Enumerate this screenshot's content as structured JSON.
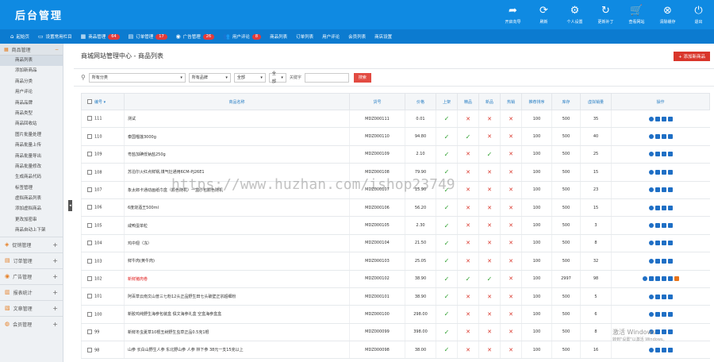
{
  "header": {
    "brand": "后台管理",
    "tools": [
      {
        "icon": "share-arrow-icon",
        "glyph": "➦",
        "label": "开启向导"
      },
      {
        "icon": "refresh-icon",
        "glyph": "⟳",
        "label": "刷新"
      },
      {
        "icon": "gear-icon",
        "glyph": "⚙",
        "label": "个人设置"
      },
      {
        "icon": "update-icon",
        "glyph": "↻",
        "label": "更新补丁"
      },
      {
        "icon": "cart-icon",
        "glyph": "🛒",
        "label": "查看网站"
      },
      {
        "icon": "clear-cache-icon",
        "glyph": "⊗",
        "label": "清除缓存"
      },
      {
        "icon": "power-icon",
        "glyph": "⏻",
        "label": "退出"
      }
    ]
  },
  "nav": [
    {
      "icon": "home-icon",
      "glyph": "⌂",
      "label": "起始页"
    },
    {
      "icon": "monitor-icon",
      "glyph": "▭",
      "label": "设置常用栏目"
    },
    {
      "icon": "goods-icon",
      "glyph": "▦",
      "label": "商品管理",
      "badge": "64"
    },
    {
      "icon": "order-icon",
      "glyph": "▤",
      "label": "订单管理",
      "badge": "17"
    },
    {
      "icon": "ad-icon",
      "glyph": "◉",
      "label": "广告管理",
      "badge": "26"
    },
    {
      "icon": "user-comment-icon",
      "glyph": "👥",
      "label": "用户评论",
      "badge": "8"
    },
    {
      "icon": "",
      "glyph": "",
      "label": "商品列表"
    },
    {
      "icon": "",
      "glyph": "",
      "label": "订单列表"
    },
    {
      "icon": "",
      "glyph": "",
      "label": "用户评论"
    },
    {
      "icon": "",
      "glyph": "",
      "label": "会员列表"
    },
    {
      "icon": "",
      "glyph": "",
      "label": "商店设置"
    }
  ],
  "sidebar": {
    "head": "商品管理",
    "items": [
      "商品列表",
      "添加新商品",
      "商品分类",
      "用户评论",
      "商品品牌",
      "商品类型",
      "商品回收站",
      "图片批量处理",
      "商品批量上传",
      "商品批量导出",
      "商品批量修改",
      "生成商品代码",
      "标签管理",
      "虚拟商品列表",
      "添加虚拟商品",
      "更改加密串",
      "商品自动上下架"
    ],
    "groups": [
      "促销管理",
      "订单管理",
      "广告管理",
      "报表统计",
      "文章管理",
      "会员管理"
    ]
  },
  "main": {
    "title": "商城网站管理中心 - 商品列表",
    "add_button": "+ 添加新商品",
    "filter": {
      "category": "所有分类",
      "brand": "所有品牌",
      "all1": "全部",
      "all2": "全部",
      "keyword_label": "关键字",
      "search": "搜索"
    },
    "columns": [
      "编号",
      "商品名称",
      "货号",
      "价格",
      "上架",
      "精品",
      "新品",
      "热销",
      "推荐排序",
      "库存",
      "虚拟销量",
      "操作"
    ],
    "rows": [
      {
        "id": "111",
        "name": "测试",
        "sku": "MDZ000111",
        "price": "0.01",
        "on": 1,
        "best": 0,
        "new": 0,
        "hot": 0,
        "sort": "100",
        "stock": "500",
        "virtual": "35"
      },
      {
        "id": "110",
        "name": "泰国榴莲3000g",
        "sku": "MDZ000110",
        "price": "94.80",
        "on": 1,
        "best": 1,
        "new": 0,
        "hot": 0,
        "sort": "100",
        "stock": "500",
        "virtual": "40"
      },
      {
        "id": "109",
        "name": "粤盐加碘低钠盐250g",
        "sku": "MDZ000109",
        "price": "2.10",
        "on": 1,
        "best": 0,
        "new": 1,
        "hot": 0,
        "sort": "100",
        "stock": "500",
        "virtual": "25"
      },
      {
        "id": "108",
        "name": "苏泊尔火红点鲜锅,煤气灶通用6CM-PJ26E1",
        "sku": "MDZ000108",
        "price": "79.90",
        "on": 1,
        "best": 0,
        "new": 0,
        "hot": 0,
        "sort": "100",
        "stock": "500",
        "virtual": "15"
      },
      {
        "id": "107",
        "name": "象太郎卡通动画纸巾盒（颜色随机）一盒小包颜色随机",
        "sku": "MDZ000107",
        "price": "15.90",
        "on": 1,
        "best": 0,
        "new": 0,
        "hot": 0,
        "sort": "100",
        "stock": "500",
        "virtual": "23"
      },
      {
        "id": "106",
        "name": "6度烧酒王500ml",
        "sku": "MDZ000106",
        "price": "56.20",
        "on": 1,
        "best": 0,
        "new": 0,
        "hot": 0,
        "sort": "100",
        "stock": "500",
        "virtual": "15"
      },
      {
        "id": "105",
        "name": "咸鸭蛋单粒",
        "sku": "MDZ000105",
        "price": "2.30",
        "on": 1,
        "best": 0,
        "new": 0,
        "hot": 0,
        "sort": "100",
        "stock": "500",
        "virtual": "3"
      },
      {
        "id": "104",
        "name": "鸡中翅（冻）",
        "sku": "MDZ000104",
        "price": "21.50",
        "on": 1,
        "best": 0,
        "new": 0,
        "hot": 0,
        "sort": "100",
        "stock": "500",
        "virtual": "8"
      },
      {
        "id": "103",
        "name": "鲜牛肉(黄牛肉)",
        "sku": "MDZ000103",
        "price": "25.05",
        "on": 1,
        "best": 0,
        "new": 0,
        "hot": 0,
        "sort": "100",
        "stock": "500",
        "virtual": "32"
      },
      {
        "id": "102",
        "name": "新鲜猪肉卷",
        "sku": "MDZ000102",
        "price": "38.90",
        "on": 1,
        "best": 1,
        "new": 1,
        "hot": 0,
        "sort": "100",
        "stock": "2997",
        "virtual": "98",
        "red": true
      },
      {
        "id": "101",
        "name": "阿百草云南文山普三七粉12头正品野生田七头破壁正宗超细粉",
        "sku": "MDZ000101",
        "price": "38.90",
        "on": 1,
        "best": 0,
        "new": 0,
        "hot": 0,
        "sort": "100",
        "stock": "500",
        "virtual": "5"
      },
      {
        "id": "100",
        "name": "新胶鸡纯野生海参包装盒 俱文海参礼盒 空盒海参盒盒",
        "sku": "MDZ000100",
        "price": "298.00",
        "on": 1,
        "best": 0,
        "new": 0,
        "hot": 0,
        "sort": "100",
        "stock": "500",
        "virtual": "6"
      },
      {
        "id": "99",
        "name": "新鲜冬虫夏草10根玉树野生虫草正品0.5克1根",
        "sku": "MDZ000099",
        "price": "398.00",
        "on": 1,
        "best": 0,
        "new": 0,
        "hot": 0,
        "sort": "100",
        "stock": "500",
        "virtual": "8"
      },
      {
        "id": "98",
        "name": "山参 长白山野生人参 东北野山参 人参 林下参 38元一支15克以上",
        "sku": "MDZ000098",
        "price": "38.00",
        "on": 1,
        "best": 0,
        "new": 0,
        "hot": 0,
        "sort": "100",
        "stock": "500",
        "virtual": "16"
      }
    ]
  },
  "watermark": "https://www.huzhan.com/ishop23749",
  "os_notice": {
    "title": "激活 Windows",
    "sub": "转到\"设置\"以激活 Windows。"
  },
  "colors": {
    "header": "#0f8ae2",
    "nav": "#0c7bd0",
    "accent_red": "#d9362b",
    "check_green": "#2ea02e",
    "link_blue": "#2b80c5"
  }
}
